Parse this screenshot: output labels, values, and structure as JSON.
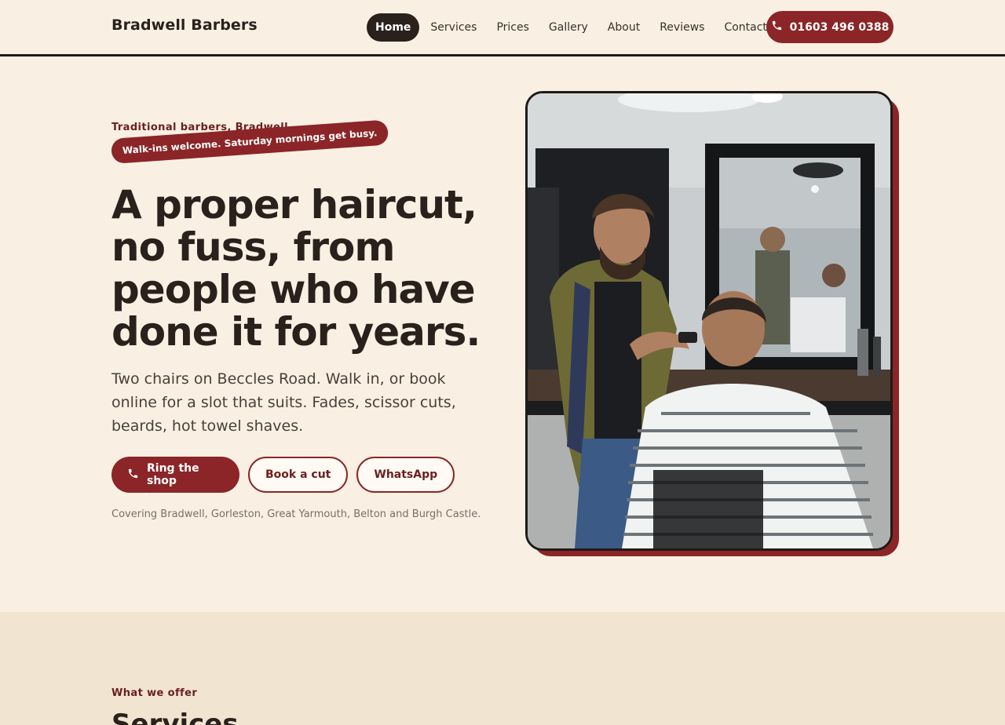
{
  "header": {
    "brand": "Bradwell Barbers",
    "nav": [
      "Home",
      "Services",
      "Prices",
      "Gallery",
      "About",
      "Reviews",
      "Contact"
    ],
    "active_nav": "Home",
    "phone_label": "01603 496 0388"
  },
  "hero": {
    "eyebrow": "Traditional barbers, Bradwell",
    "stamp": "Walk-ins welcome. Saturday mornings get busy.",
    "headline": "A proper haircut, no fuss, from people who have done it for years.",
    "intro": "Two chairs on Beccles Road. Walk in, or book online for a slot that suits. Fades, scissor cuts, beards, hot towel shaves.",
    "buttons": {
      "ring": "Ring the shop",
      "book": "Book a cut",
      "whatsapp": "WhatsApp"
    },
    "coverage": "Covering Bradwell, Gorleston, Great Yarmouth, Belton and Burgh Castle."
  },
  "services": {
    "eyebrow": "What we offer",
    "title": "Services"
  },
  "colors": {
    "accent": "#8b2527",
    "dark": "#2a211d",
    "background": "#f9f0e3",
    "band": "#f1e4d0"
  },
  "icons": {
    "phone": "phone-icon"
  }
}
